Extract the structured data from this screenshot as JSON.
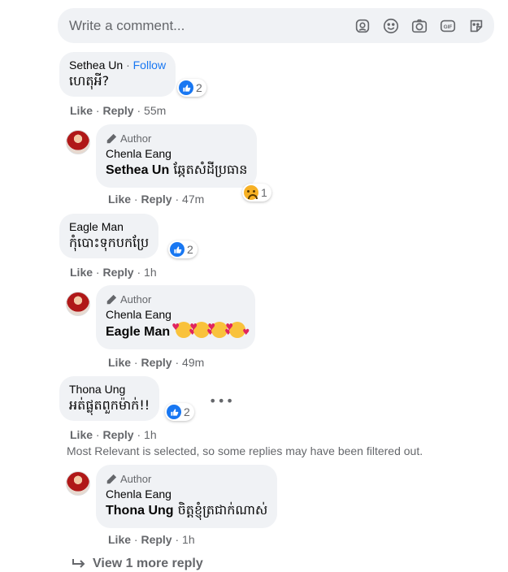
{
  "composer": {
    "placeholder": "Write a comment..."
  },
  "comments": [
    {
      "author": "Sethea Un",
      "follow": "Follow",
      "text": "ហេតុអី?",
      "actions": {
        "like": "Like",
        "reply": "Reply",
        "time": "55m"
      },
      "reaction": {
        "type": "like",
        "count": "2"
      },
      "reply": {
        "badge": "Author",
        "author": "Chenla Eang",
        "tag": "Sethea Un",
        "text": "ឆ្កែតសំដីប្រធាន",
        "actions": {
          "like": "Like",
          "reply": "Reply",
          "time": "47m"
        },
        "reaction": {
          "type": "sad",
          "count": "1"
        }
      }
    },
    {
      "author": "Eagle Man",
      "text": "កុំបោះទុកបកប្រែ",
      "actions": {
        "like": "Like",
        "reply": "Reply",
        "time": "1h"
      },
      "reaction": {
        "type": "like",
        "count": "2"
      },
      "reply": {
        "badge": "Author",
        "author": "Chenla Eang",
        "tag": "Eagle Man",
        "text": "",
        "emoji_count": 4,
        "actions": {
          "like": "Like",
          "reply": "Reply",
          "time": "49m"
        }
      }
    },
    {
      "author": "Thona Ung",
      "text": "អត់ផ្លុតពួកម៉ាក់!!",
      "actions": {
        "like": "Like",
        "reply": "Reply",
        "time": "1h"
      },
      "reaction": {
        "type": "like",
        "count": "2"
      },
      "notice": "Most Relevant is selected, so some replies may have been filtered out.",
      "reply": {
        "badge": "Author",
        "author": "Chenla Eang",
        "tag": "Thona Ung",
        "text": "ចិត្តខ្ញុំត្រជាក់ណាស់",
        "actions": {
          "like": "Like",
          "reply": "Reply",
          "time": "1h"
        }
      }
    }
  ],
  "view_more": "View 1 more reply",
  "separator": "·",
  "colors": {
    "bubble": "#f0f2f5",
    "link": "#1877f2",
    "meta": "#65676b"
  }
}
